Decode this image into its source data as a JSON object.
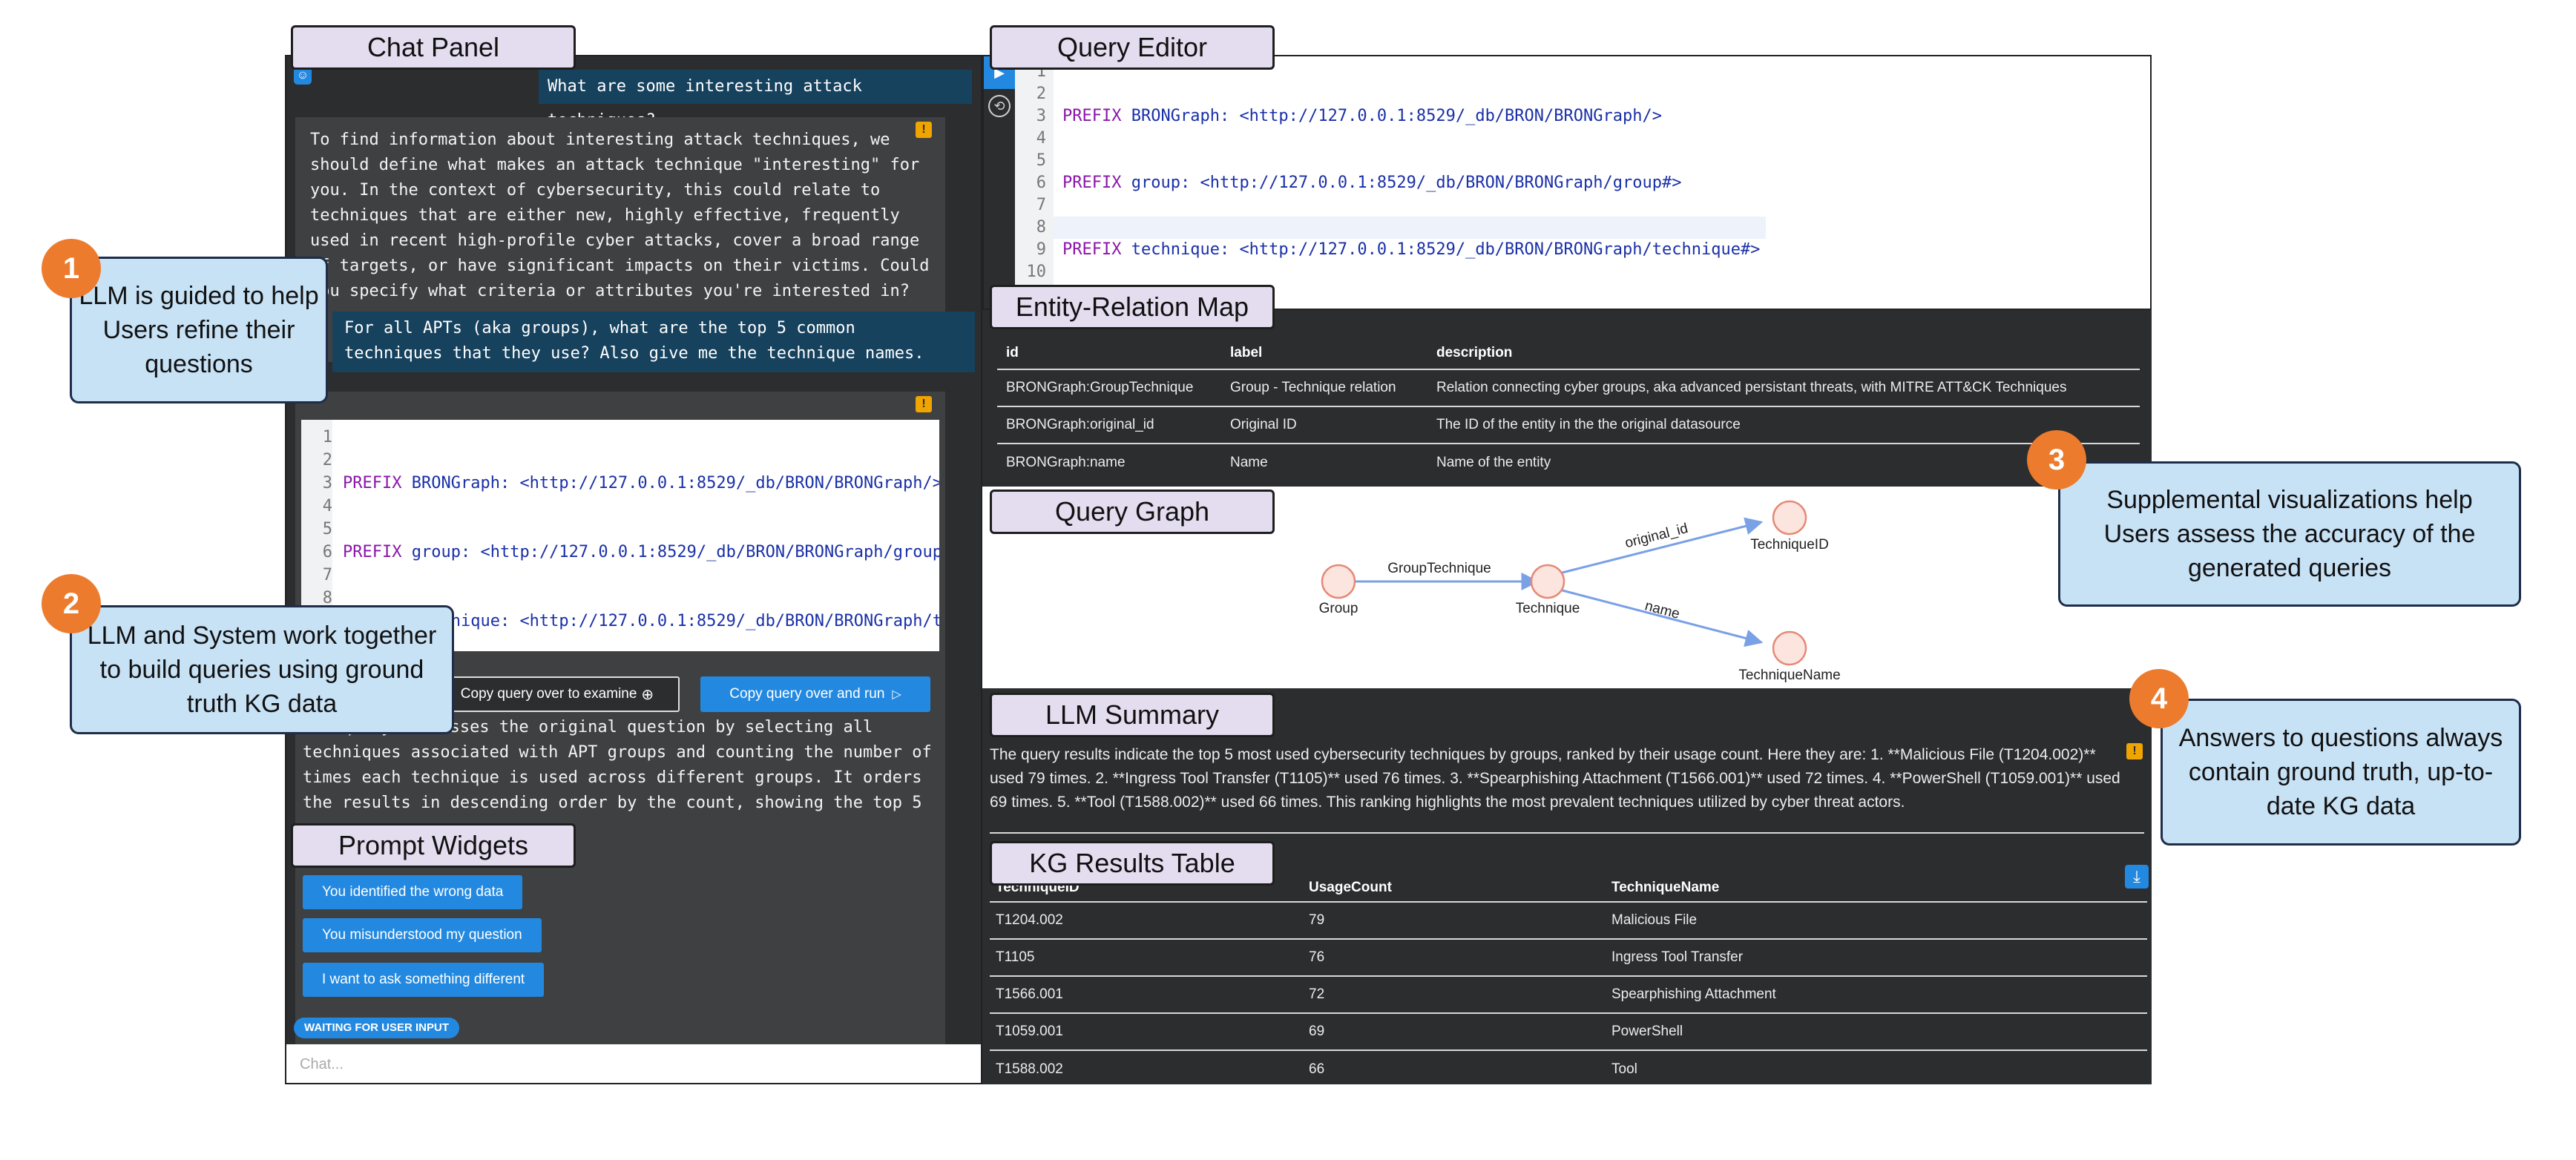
{
  "labels": {
    "chat_panel": "Chat Panel",
    "query_editor": "Query Editor",
    "er_map": "Entity-Relation Map",
    "query_graph": "Query Graph",
    "llm_summary": "LLM Summary",
    "kg_results": "KG Results Table",
    "prompt_widgets": "Prompt Widgets"
  },
  "callouts": [
    {
      "num": "1",
      "text": "LLM is guided to help Users refine their questions"
    },
    {
      "num": "2",
      "text": "LLM and System work together to build queries using ground truth KG data"
    },
    {
      "num": "3",
      "text": "Supplemental visualizations help Users assess the accuracy of the generated queries"
    },
    {
      "num": "4",
      "text": "Answers to questions always contain ground truth, up-to-date KG data"
    }
  ],
  "chat": {
    "user_msg_1": "What are some interesting attack techniques?",
    "llm_msg_1": "To find information about interesting attack techniques, we should define what makes an attack technique \"interesting\" for you. In the context of cybersecurity, this could relate to techniques that are either new, highly effective, frequently used in recent high-profile cyber attacks, cover a broad range of targets, or have significant impacts on their victims. Could you specify what criteria or attributes you're interested in?",
    "user_msg_2": "For all APTs (aka groups), what are the top 5 common techniques that they use? Also give me the technique names.",
    "copy_examine": "Copy query over to examine",
    "copy_run": "Copy query over and run",
    "explanation": "The query addresses the original question by selecting all techniques associated with APT groups and counting the number of times each technique is used across different groups. It orders the results in descending order by the count, showing the top 5 most common techniques. Additionally, it returns the IDs and",
    "widgets": [
      "You identified the wrong data",
      "You misunderstood my question",
      "I want to ask something different"
    ],
    "status": "WAITING FOR USER INPUT",
    "input_placeholder": "Chat..."
  },
  "er_map": {
    "headers": [
      "id",
      "label",
      "description"
    ],
    "rows": [
      [
        "BRONGraph:GroupTechnique",
        "Group - Technique relation",
        "Relation connecting cyber groups, aka advanced persistant threats, with MITRE ATT&CK Techniques"
      ],
      [
        "BRONGraph:original_id",
        "Original ID",
        "The ID of the entity in the the original datasource"
      ],
      [
        "BRONGraph:name",
        "Name",
        "Name of the entity"
      ]
    ]
  },
  "graph": {
    "nodes": [
      "Group",
      "Technique",
      "TechniqueID",
      "TechniqueName"
    ],
    "edges": [
      "GroupTechnique",
      "original_id",
      "name"
    ]
  },
  "summary": {
    "text": "The query results indicate the top 5 most used cybersecurity techniques by groups, ranked by their usage count. Here they are: 1. **Malicious File (T1204.002)** used 79 times. 2. **Ingress Tool Transfer (T1105)** used 76 times. 3. **Spearphishing Attachment (T1566.001)** used 72 times. 4. **PowerShell (T1059.001)** used 69 times. 5. **Tool (T1588.002)** used 66 times. This ranking highlights the most prevalent techniques utilized by cyber threat actors."
  },
  "results": {
    "headers": [
      "TechniqueID",
      "UsageCount",
      "TechniqueName"
    ],
    "rows": [
      [
        "T1204.002",
        "79",
        "Malicious File"
      ],
      [
        "T1105",
        "76",
        "Ingress Tool Transfer"
      ],
      [
        "T1566.001",
        "72",
        "Spearphishing Attachment"
      ],
      [
        "T1059.001",
        "69",
        "PowerShell"
      ],
      [
        "T1588.002",
        "66",
        "Tool"
      ]
    ]
  },
  "colors": {
    "panel_dark": "#2c2d2f",
    "accent_blue": "#2389e0",
    "user_bubble": "#16425e",
    "callout_bg": "#c7e1f5",
    "label_bg": "#e4dcef",
    "number_badge": "#ec7b2d"
  }
}
